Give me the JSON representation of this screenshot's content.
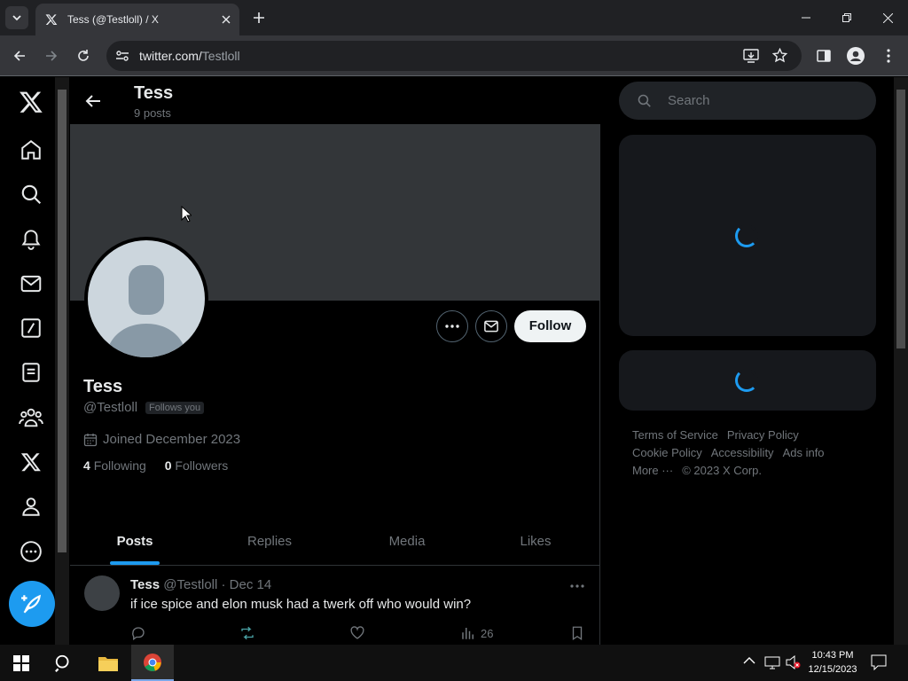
{
  "browser": {
    "tab_title": "Tess (@Testloll) / X",
    "url_host": "twitter.com/",
    "url_path": "Testloll"
  },
  "header": {
    "name": "Tess",
    "post_count": "9 posts"
  },
  "profile": {
    "name": "Tess",
    "handle": "@Testloll",
    "follows_you": "Follows you",
    "joined": "Joined December 2023",
    "following_count": "4",
    "following_label": "Following",
    "followers_count": "0",
    "followers_label": "Followers",
    "follow_button": "Follow"
  },
  "tabs": [
    "Posts",
    "Replies",
    "Media",
    "Likes"
  ],
  "post": {
    "name": "Tess",
    "handle": "@Testloll",
    "date": "· Dec 14",
    "text": "if ice spice and elon musk had a twerk off who would win?",
    "views": "26"
  },
  "sidebar": {
    "search_placeholder": "Search",
    "footer": {
      "terms": "Terms of Service",
      "privacy": "Privacy Policy",
      "cookie": "Cookie Policy",
      "accessibility": "Accessibility",
      "ads": "Ads info",
      "more": "More ···",
      "copyright": "© 2023 X Corp."
    }
  },
  "taskbar": {
    "time": "10:43 PM",
    "date": "12/15/2023"
  },
  "colors": {
    "accent": "#1d9bf0",
    "banner": "#333639"
  }
}
